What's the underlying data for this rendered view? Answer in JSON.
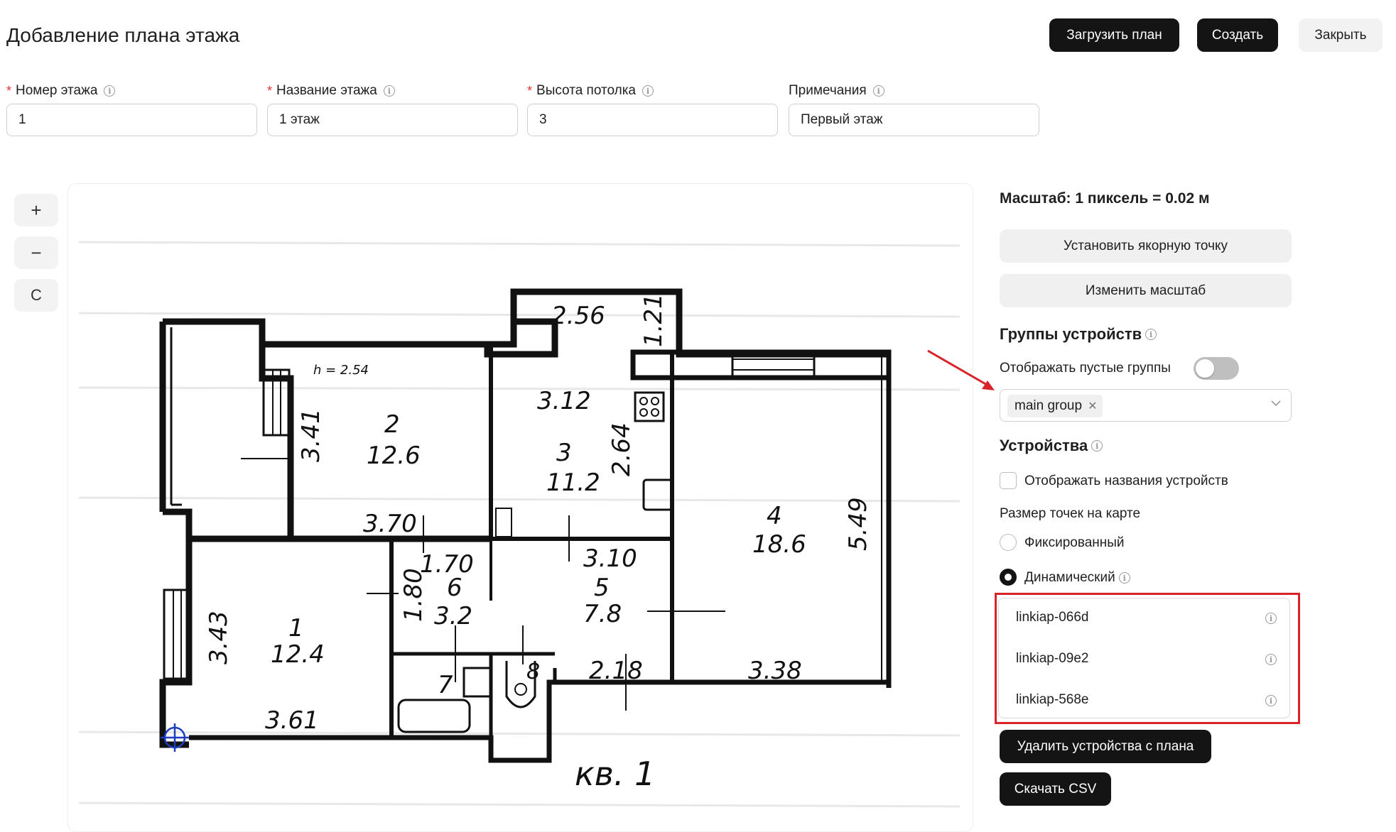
{
  "header": {
    "title": "Добавление плана этажа",
    "upload_label": "Загрузить план",
    "create_label": "Создать",
    "close_label": "Закрыть"
  },
  "form": {
    "floor_number": {
      "label": "Номер этажа",
      "value": "1",
      "required": true
    },
    "floor_name": {
      "label": "Название этажа",
      "value": "1 этаж",
      "required": true
    },
    "ceiling_height": {
      "label": "Высота потолка",
      "value": "3",
      "required": true
    },
    "notes": {
      "label": "Примечания",
      "value": "Первый этаж",
      "required": false
    }
  },
  "zoom_controls": {
    "zoom_in": "+",
    "zoom_out": "−",
    "reset": "C"
  },
  "plan": {
    "labels": {
      "r256": "2.56",
      "r121": "1.21",
      "h": "h = 2.54",
      "r2": "2",
      "r126": "12.6",
      "r341": "3.41",
      "r312": "3.12",
      "r3": "3",
      "r112": "11.2",
      "r264": "2.64",
      "r370": "3.70",
      "r4": "4",
      "r186": "18.6",
      "r549": "5.49",
      "r170": "1.70",
      "r310": "3.10",
      "r180": "1.80",
      "r6": "6",
      "r32": "3.2",
      "r5": "5",
      "r78": "7.8",
      "r343": "3.43",
      "r1": "1",
      "r124": "12.4",
      "r7": "7",
      "r8": "8",
      "r218": "2.18",
      "r338": "3.38",
      "r361": "3.61",
      "caption": "кв. 1"
    }
  },
  "sidebar": {
    "scale_text": "Масштаб: 1 пиксель = 0.02 м",
    "anchor_button": "Установить якорную точку",
    "scale_button": "Изменить масштаб",
    "groups_title": "Группы устройств",
    "show_empty_label": "Отображать пустые группы",
    "show_empty_on": false,
    "selected_group": "main group",
    "devices_title": "Устройства",
    "show_names_label": "Отображать названия устройств",
    "dot_size_label": "Размер точек на карте",
    "fixed_label": "Фиксированный",
    "dynamic_label": "Динамический",
    "selected_dot_mode": "dynamic",
    "devices": [
      "linkiap-066d",
      "linkiap-09e2",
      "linkiap-568e"
    ],
    "delete_button": "Удалить устройства с плана",
    "csv_button": "Скачать CSV"
  }
}
